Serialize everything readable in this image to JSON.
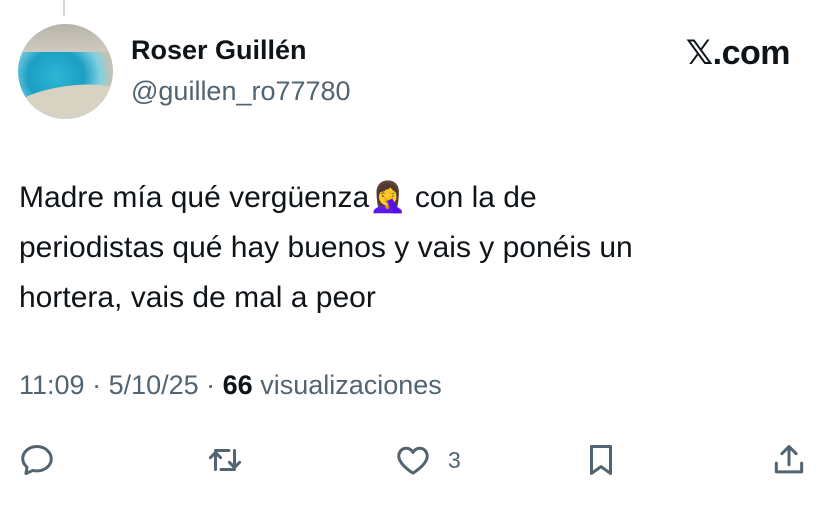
{
  "author": {
    "name": "Roser Guillén",
    "handle": "@guillen_ro77780"
  },
  "brand": "𝕏.com",
  "tweet": {
    "text_line1_a": "Madre mía qué vergüenza",
    "emoji": "🤦‍♀️",
    "text_line1_b": " con la de",
    "text_line2": "periodistas qué hay buenos y vais y ponéis un",
    "text_line3": "hortera, vais de mal a peor"
  },
  "meta": {
    "time": "11:09",
    "sep1": " · ",
    "date": "5/10/25",
    "sep2": " · ",
    "views_count": "66",
    "views_label": " visualizaciones"
  },
  "actions": {
    "reply_icon": "speech-bubble-icon",
    "retweet_icon": "retweet-icon",
    "like_icon": "heart-icon",
    "like_count": "3",
    "bookmark_icon": "bookmark-icon",
    "share_icon": "share-icon"
  },
  "colors": {
    "primary_text": "#0f1419",
    "secondary_text": "#536471"
  }
}
